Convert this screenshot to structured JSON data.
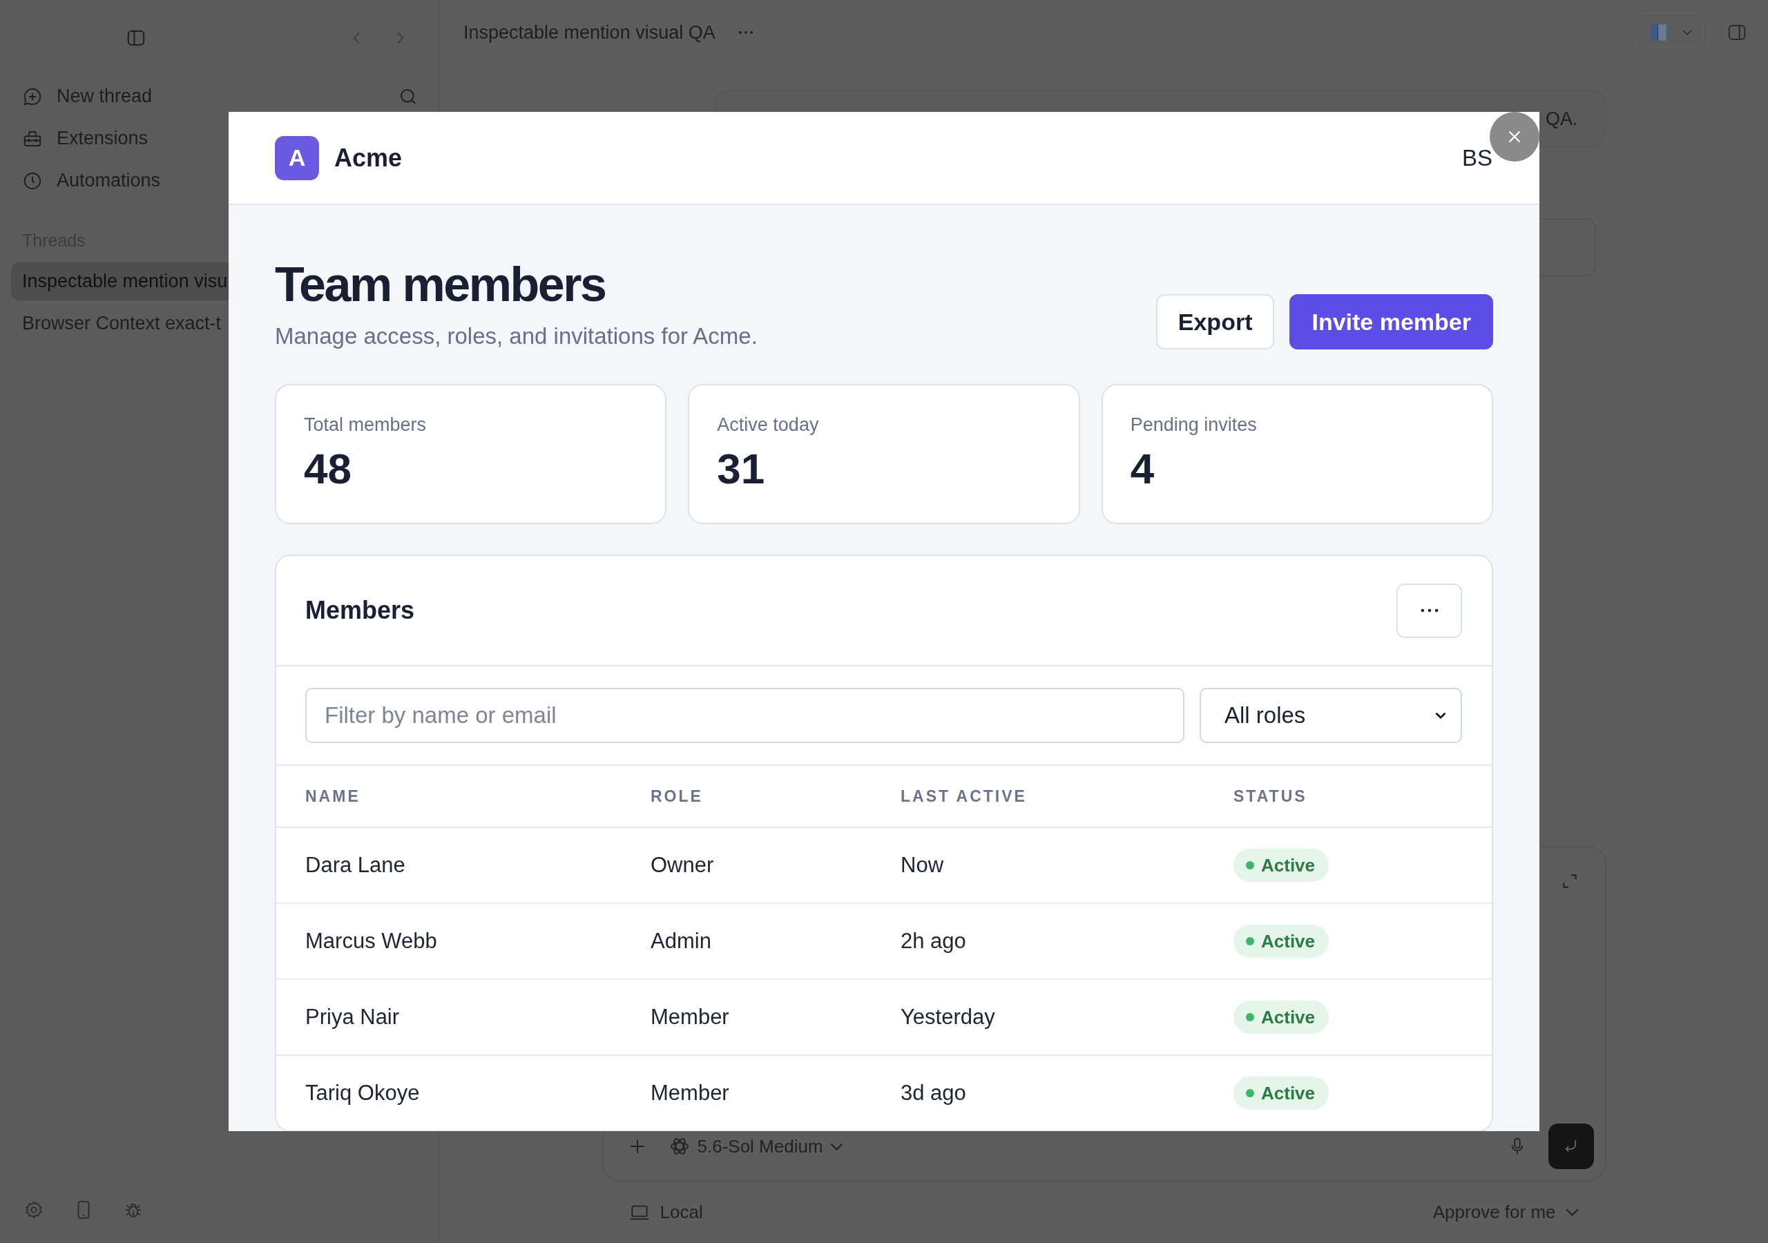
{
  "sidebar": {
    "items": [
      {
        "label": "New thread",
        "kind": "new"
      },
      {
        "label": "Extensions",
        "kind": "extensions"
      },
      {
        "label": "Automations",
        "kind": "automations"
      }
    ],
    "section_title": "Threads",
    "threads": [
      {
        "title": "Inspectable mention visu",
        "selected": true
      },
      {
        "title": "Browser Context exact-t",
        "selected": false
      }
    ]
  },
  "topbar": {
    "title": "Inspectable mention visual QA"
  },
  "chat": {
    "message_fragment": "QA."
  },
  "composer": {
    "model": "5.6-Sol Medium",
    "environment": "Local",
    "approval": "Approve for me"
  },
  "modal": {
    "org": {
      "initial": "A",
      "name": "Acme"
    },
    "user_initials": "BS",
    "title": "Team members",
    "subtitle": "Manage access, roles, and invitations for Acme.",
    "actions": [
      {
        "label": "Export",
        "kind": "secondary"
      },
      {
        "label": "Invite member",
        "kind": "primary"
      }
    ],
    "stats": [
      {
        "label": "Total members",
        "value": "48"
      },
      {
        "label": "Active today",
        "value": "31"
      },
      {
        "label": "Pending invites",
        "value": "4"
      }
    ],
    "members": {
      "title": "Members",
      "filter": {
        "placeholder": "Filter by name or email"
      },
      "role_select": {
        "value": "All roles"
      },
      "columns": [
        "NAME",
        "ROLE",
        "LAST ACTIVE",
        "STATUS"
      ],
      "rows": [
        {
          "name": "Dara Lane",
          "role": "Owner",
          "last_active": "Now",
          "status": "Active"
        },
        {
          "name": "Marcus Webb",
          "role": "Admin",
          "last_active": "2h ago",
          "status": "Active"
        },
        {
          "name": "Priya Nair",
          "role": "Member",
          "last_active": "Yesterday",
          "status": "Active"
        },
        {
          "name": "Tariq Okoye",
          "role": "Member",
          "last_active": "3d ago",
          "status": "Active"
        }
      ]
    }
  }
}
